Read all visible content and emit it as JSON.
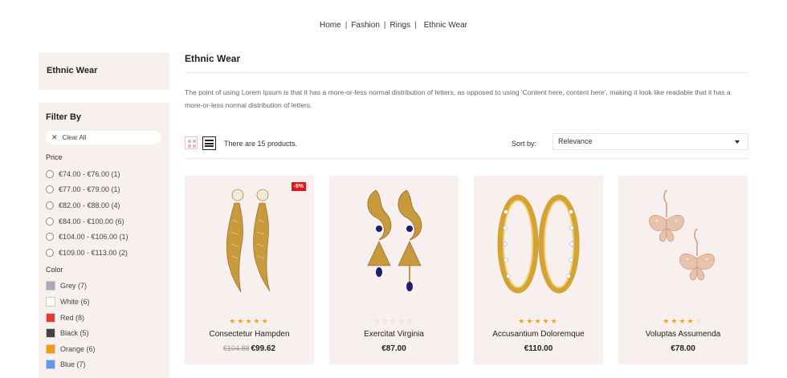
{
  "breadcrumb": [
    "Home",
    "Fashion",
    "Rings",
    "Ethnic Wear"
  ],
  "sidebar": {
    "block_title": "Ethnic Wear",
    "filter_title": "Filter By",
    "clear_all": "Clear All",
    "price_title": "Price",
    "prices": [
      "€74.00 - €76.00 (1)",
      "€77.00 - €79.00 (1)",
      "€82.00 - €88.00 (4)",
      "€84.00 - €100.00 (6)",
      "€104.00 - €106.00 (1)",
      "€109.00 - €113.00 (2)"
    ],
    "color_title": "Color",
    "colors": [
      {
        "label": "Grey (7)",
        "hex": "#a8adb4"
      },
      {
        "label": "White (6)",
        "hex": "#ffffff"
      },
      {
        "label": "Red (8)",
        "hex": "#e23f34"
      },
      {
        "label": "Black (5)",
        "hex": "#434343"
      },
      {
        "label": "Orange (6)",
        "hex": "#f39c11"
      },
      {
        "label": "Blue (7)",
        "hex": "#5d9cec"
      }
    ]
  },
  "main": {
    "title": "Ethnic Wear",
    "description": "The point of using Lorem Ipsum is that it has a more-or-less normal distribution of letters, as opposed to using 'Content here, content here', making it look like readable that it has a more-or-less normal distribution of letters.",
    "product_count": "There are 15 products.",
    "sort_label": "Sort by:",
    "sort_value": "Relevance"
  },
  "products": [
    {
      "name": "Consectetur Hampden",
      "old_price": "€104.88",
      "price": "€99.62",
      "badge": "-5%",
      "rating": 5
    },
    {
      "name": "Exercitat Virginia",
      "old_price": "",
      "price": "€87.00",
      "badge": "",
      "rating": 0
    },
    {
      "name": "Accusantium Doloremque",
      "old_price": "",
      "price": "€110.00",
      "badge": "",
      "rating": 5
    },
    {
      "name": "Voluptas Assumenda",
      "old_price": "",
      "price": "€78.00",
      "badge": "",
      "rating": 4
    }
  ],
  "icons": {
    "clear": "close-icon",
    "grid_view": "grid-view-icon",
    "list_view": "list-view-icon",
    "sort_caret": "caret-down-icon",
    "star": "star-icon"
  },
  "colors": {
    "panel_bg": "#f7f0ef",
    "star": "#f5a31a",
    "sale_badge": "#e01515",
    "gold": "#c99a3c"
  }
}
